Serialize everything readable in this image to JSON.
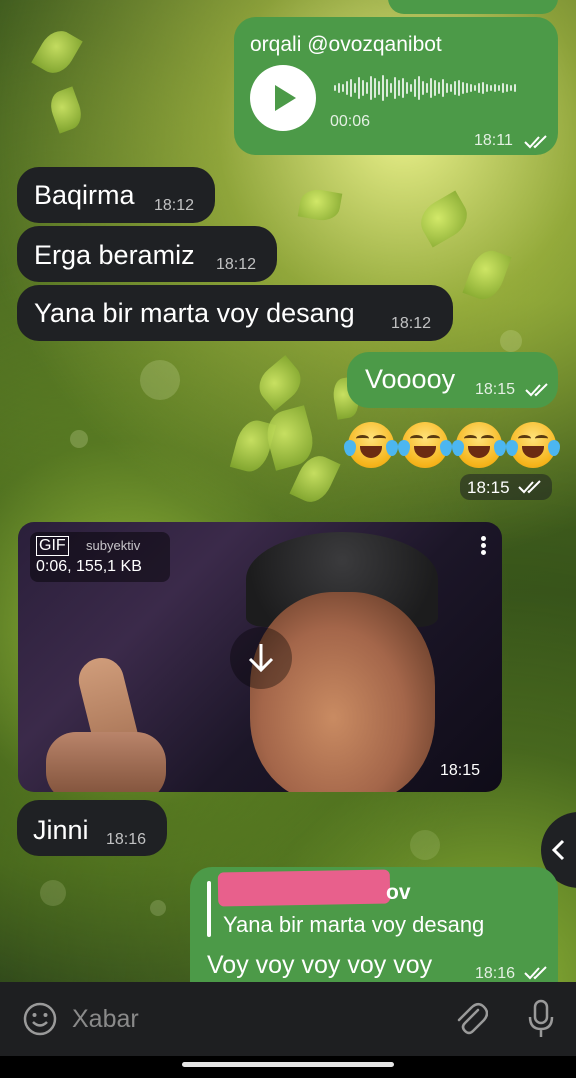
{
  "messages": [
    {
      "id": "audio",
      "direction": "out",
      "caption": "orqali @ovozqanibot",
      "duration": "00:06",
      "time": "18:11",
      "status": "read",
      "icon": "play-icon"
    },
    {
      "id": "m1",
      "direction": "in",
      "text": "Baqirma",
      "time": "18:12"
    },
    {
      "id": "m2",
      "direction": "in",
      "text": "Erga beramiz",
      "time": "18:12"
    },
    {
      "id": "m3",
      "direction": "in",
      "text": "Yana bir marta voy desang",
      "time": "18:12"
    },
    {
      "id": "m4",
      "direction": "out",
      "text": "Vooooy",
      "time": "18:15",
      "status": "read"
    },
    {
      "id": "m5",
      "direction": "out",
      "emoji": [
        "face-with-tears-of-joy",
        "face-with-tears-of-joy",
        "face-with-tears-of-joy",
        "face-with-tears-of-joy"
      ],
      "time": "18:15",
      "status": "read"
    },
    {
      "id": "gif",
      "direction": "in",
      "badge": "GIF",
      "channel": "subyektiv",
      "meta": "0:06, 155,1 KB",
      "time": "18:15",
      "icon": "download-icon"
    },
    {
      "id": "m6",
      "direction": "in",
      "text": "Jinni",
      "time": "18:16"
    },
    {
      "id": "m7",
      "direction": "out",
      "reply_author_suffix": "ov",
      "reply_text": "Yana bir marta voy desang",
      "text": "Voy voy voy voy voy",
      "time": "18:16",
      "status": "read"
    }
  ],
  "composer": {
    "placeholder": "Xabar",
    "emoji_icon": "smiley-icon",
    "attach_icon": "paperclip-icon",
    "mic_icon": "microphone-icon"
  },
  "colors": {
    "incoming": "#1f2124",
    "outgoing": "#4c9a48",
    "redaction": "#e8608c"
  }
}
